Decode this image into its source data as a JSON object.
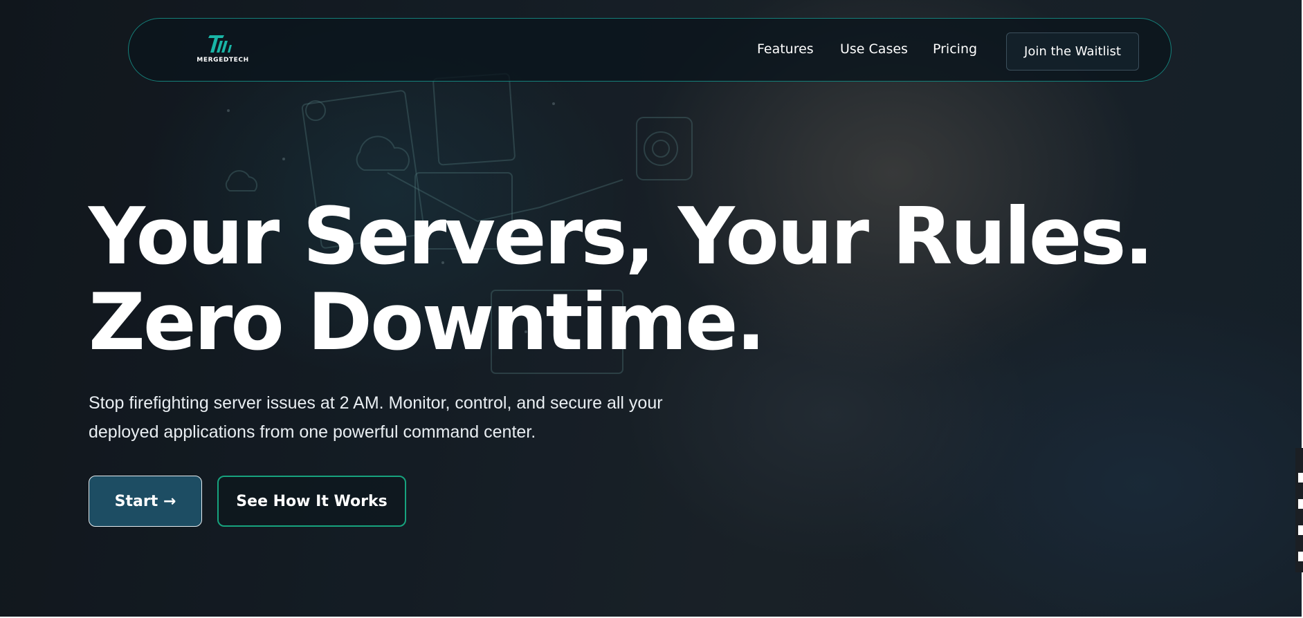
{
  "brand": {
    "name": "MERGEDTECH",
    "logo_icon": "mergedtech-logo-mark",
    "accent_color": "#17a37e",
    "logo_color": "#19b5a6"
  },
  "nav": {
    "links": [
      {
        "label": "Features"
      },
      {
        "label": "Use Cases"
      },
      {
        "label": "Pricing"
      }
    ],
    "cta_label": "Join the Waitlist"
  },
  "hero": {
    "headline_line1": "Your Servers, Your Rules.",
    "headline_line2": "Zero Downtime.",
    "subheading": "Stop firefighting server issues at 2 AM. Monitor, control, and secure all your deployed applications from one powerful command center.",
    "primary_button": "Start →",
    "secondary_button": "See How It Works"
  }
}
